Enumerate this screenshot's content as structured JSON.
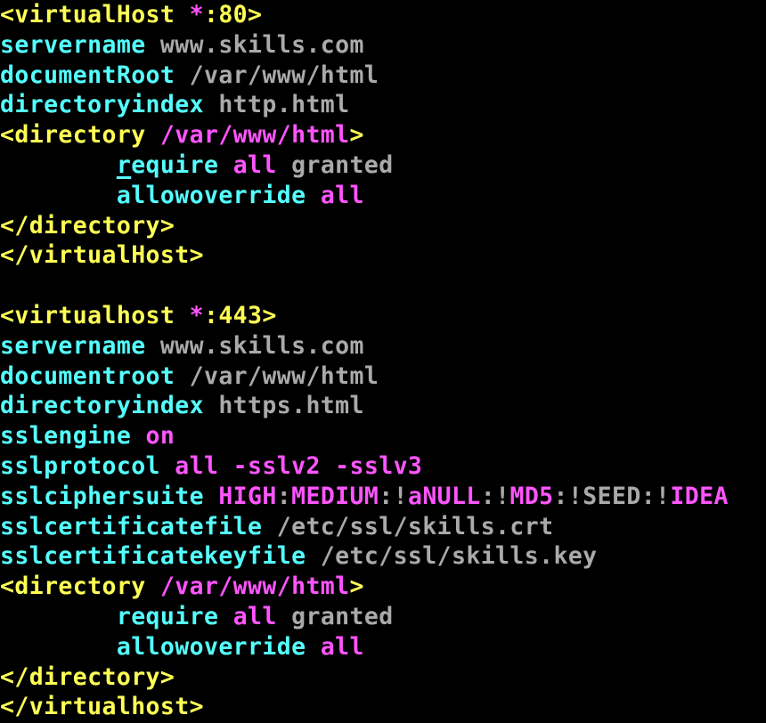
{
  "colors": {
    "yellow": "#ffff55",
    "cyan": "#55ffff",
    "magenta": "#ff55ff",
    "gray": "#aaaaaa",
    "background": "#000000"
  },
  "lines": [
    [
      {
        "t": "<virtualHost ",
        "c": "yellow"
      },
      {
        "t": "*",
        "c": "magenta"
      },
      {
        "t": ":80>",
        "c": "yellow"
      }
    ],
    [
      {
        "t": "servername ",
        "c": "cyan"
      },
      {
        "t": "www.skills.com",
        "c": "gray"
      }
    ],
    [
      {
        "t": "documentRoot ",
        "c": "cyan"
      },
      {
        "t": "/var/www/html",
        "c": "gray"
      }
    ],
    [
      {
        "t": "directoryindex ",
        "c": "cyan"
      },
      {
        "t": "http.html",
        "c": "gray"
      }
    ],
    [
      {
        "t": "<directory ",
        "c": "yellow"
      },
      {
        "t": "/var/www/html",
        "c": "magenta"
      },
      {
        "t": ">",
        "c": "yellow"
      }
    ],
    [
      {
        "t": "        ",
        "c": "gray"
      },
      {
        "t": "r",
        "c": "cyan",
        "cursor": true
      },
      {
        "t": "equire ",
        "c": "cyan"
      },
      {
        "t": "all ",
        "c": "magenta"
      },
      {
        "t": "granted",
        "c": "gray"
      }
    ],
    [
      {
        "t": "        ",
        "c": "gray"
      },
      {
        "t": "allowoverride ",
        "c": "cyan"
      },
      {
        "t": "all",
        "c": "magenta"
      }
    ],
    [
      {
        "t": "</directory>",
        "c": "yellow"
      }
    ],
    [
      {
        "t": "</virtualHost>",
        "c": "yellow"
      }
    ],
    [],
    [
      {
        "t": "<virtualhost ",
        "c": "yellow"
      },
      {
        "t": "*",
        "c": "magenta"
      },
      {
        "t": ":443>",
        "c": "yellow"
      }
    ],
    [
      {
        "t": "servername ",
        "c": "cyan"
      },
      {
        "t": "www.skills.com",
        "c": "gray"
      }
    ],
    [
      {
        "t": "documentroot ",
        "c": "cyan"
      },
      {
        "t": "/var/www/html",
        "c": "gray"
      }
    ],
    [
      {
        "t": "directoryindex ",
        "c": "cyan"
      },
      {
        "t": "https.html",
        "c": "gray"
      }
    ],
    [
      {
        "t": "sslengine ",
        "c": "cyan"
      },
      {
        "t": "on",
        "c": "magenta"
      }
    ],
    [
      {
        "t": "sslprotocol ",
        "c": "cyan"
      },
      {
        "t": "all -sslv2 -sslv3",
        "c": "magenta"
      }
    ],
    [
      {
        "t": "sslciphersuite ",
        "c": "cyan"
      },
      {
        "t": "HIGH",
        "c": "magenta"
      },
      {
        "t": ":",
        "c": "gray"
      },
      {
        "t": "MEDIUM",
        "c": "magenta"
      },
      {
        "t": ":",
        "c": "gray"
      },
      {
        "t": "!",
        "c": "gray"
      },
      {
        "t": "aNULL",
        "c": "magenta"
      },
      {
        "t": ":",
        "c": "gray"
      },
      {
        "t": "!",
        "c": "gray"
      },
      {
        "t": "MD5",
        "c": "magenta"
      },
      {
        "t": ":",
        "c": "gray"
      },
      {
        "t": "!SEED",
        "c": "gray"
      },
      {
        "t": ":",
        "c": "gray"
      },
      {
        "t": "!",
        "c": "gray"
      },
      {
        "t": "IDEA",
        "c": "magenta"
      }
    ],
    [
      {
        "t": "sslcertificatefile ",
        "c": "cyan"
      },
      {
        "t": "/etc/ssl/skills.crt",
        "c": "gray"
      }
    ],
    [
      {
        "t": "sslcertificatekeyfile ",
        "c": "cyan"
      },
      {
        "t": "/etc/ssl/skills.key",
        "c": "gray"
      }
    ],
    [
      {
        "t": "<directory ",
        "c": "yellow"
      },
      {
        "t": "/var/www/html",
        "c": "magenta"
      },
      {
        "t": ">",
        "c": "yellow"
      }
    ],
    [
      {
        "t": "        ",
        "c": "gray"
      },
      {
        "t": "require ",
        "c": "cyan"
      },
      {
        "t": "all ",
        "c": "magenta"
      },
      {
        "t": "granted",
        "c": "gray"
      }
    ],
    [
      {
        "t": "        ",
        "c": "gray"
      },
      {
        "t": "allowoverride ",
        "c": "cyan"
      },
      {
        "t": "all",
        "c": "magenta"
      }
    ],
    [
      {
        "t": "</directory>",
        "c": "yellow"
      }
    ],
    [
      {
        "t": "</virtualhost>",
        "c": "yellow"
      }
    ]
  ]
}
